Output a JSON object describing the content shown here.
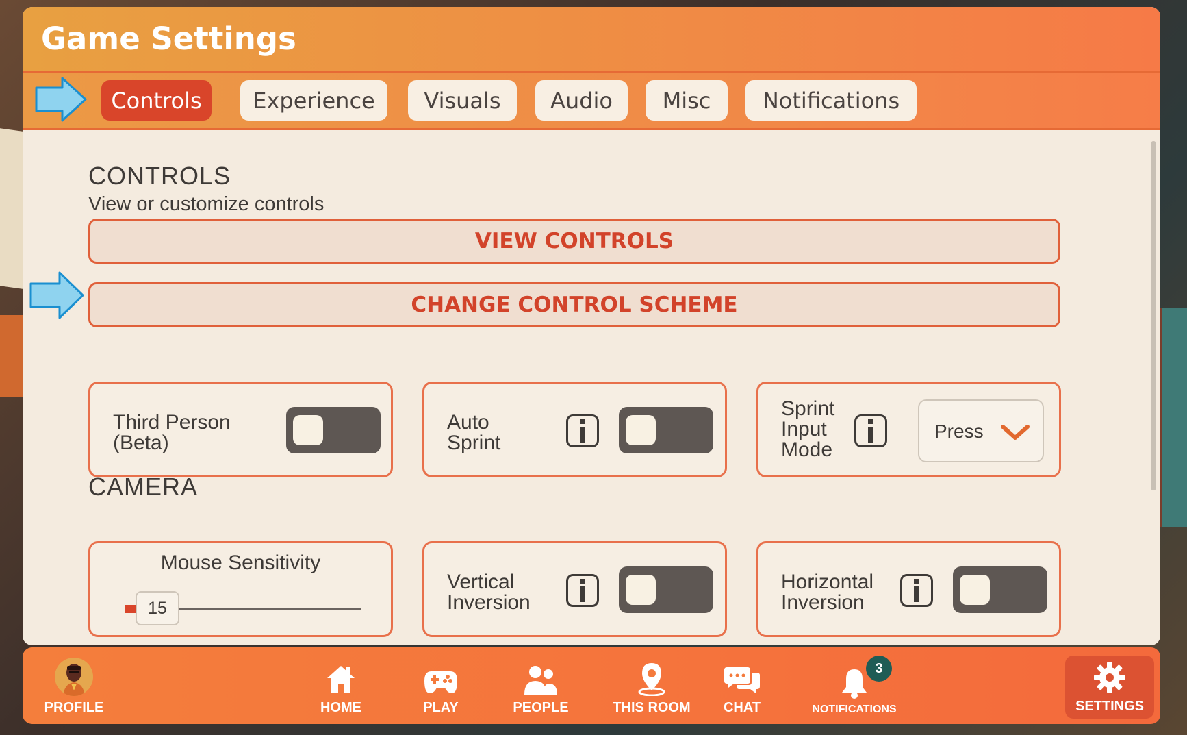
{
  "header": {
    "title": "Game Settings"
  },
  "tabs": [
    {
      "label": "Controls",
      "active": true
    },
    {
      "label": "Experience",
      "active": false
    },
    {
      "label": "Visuals",
      "active": false
    },
    {
      "label": "Audio",
      "active": false
    },
    {
      "label": "Misc",
      "active": false
    },
    {
      "label": "Notifications",
      "active": false
    }
  ],
  "controls": {
    "title": "CONTROLS",
    "subtitle": "View or customize controls",
    "view_controls": "VIEW CONTROLS",
    "change_scheme": "CHANGE CONTROL SCHEME",
    "third_person": {
      "label_line1": "Third Person",
      "label_line2": "(Beta)",
      "enabled": false
    },
    "auto_sprint": {
      "label_line1": "Auto",
      "label_line2": "Sprint",
      "enabled": false
    },
    "sprint_input_mode": {
      "label_line1": "Sprint",
      "label_line2": "Input",
      "label_line3": "Mode",
      "value": "Press"
    }
  },
  "camera": {
    "title": "CAMERA",
    "mouse_sensitivity": {
      "label": "Mouse Sensitivity",
      "value": "15",
      "fraction": 0.05
    },
    "vertical_inversion": {
      "label_line1": "Vertical",
      "label_line2": "Inversion",
      "enabled": false
    },
    "horizontal_inversion": {
      "label_line1": "Horizontal",
      "label_line2": "Inversion",
      "enabled": false
    }
  },
  "nav": {
    "profile": "PROFILE",
    "home": "HOME",
    "play": "PLAY",
    "people": "PEOPLE",
    "this_room": "THIS ROOM",
    "chat": "CHAT",
    "notifications": "NOTIFICATIONS",
    "notifications_badge": "3",
    "settings": "SETTINGS"
  },
  "colors": {
    "accent": "#d9452a",
    "header": "#f08a45",
    "panel_bg": "#f4ebdf",
    "arrow": "#7fd0ef"
  }
}
